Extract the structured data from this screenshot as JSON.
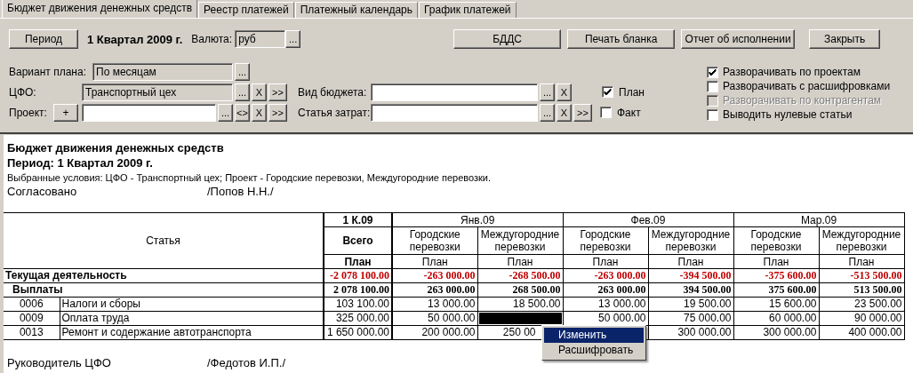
{
  "tabs": [
    {
      "label": "Бюджет движения денежных средств",
      "selected": true
    },
    {
      "label": "Реестр платежей",
      "selected": false
    },
    {
      "label": "Платежный календарь",
      "selected": false
    },
    {
      "label": "График платежей",
      "selected": false
    }
  ],
  "toolbar": {
    "period_button": "Период",
    "period_value": "1 Квартал 2009 г.",
    "currency_label": "Валюта:",
    "currency_value": "руб",
    "currency_picker": "...",
    "buttons": [
      "БДДС",
      "Печать бланка",
      "Отчет об исполнении",
      "Закрыть"
    ]
  },
  "filters": {
    "plan_variant": {
      "label": "Вариант плана:",
      "value": "По месяцам",
      "picker": "..."
    },
    "cfo": {
      "label": "ЦФО:",
      "value": "Транспортный цех",
      "picker": "...",
      "clear": "X",
      "expand": ">>"
    },
    "project": {
      "label": "Проект:",
      "add": "+",
      "picker": "...",
      "toggle": "<>",
      "clear": "X",
      "expand": ">>"
    },
    "budget_type": {
      "label": "Вид бюджета:",
      "picker": "...",
      "clear": "X"
    },
    "expense_item": {
      "label": "Статья затрат:",
      "picker": "...",
      "clear": "X",
      "expand": ">>"
    },
    "data_kinds": [
      {
        "label": "План",
        "checked": true
      },
      {
        "label": "Факт",
        "checked": false
      }
    ],
    "options": [
      {
        "label": "Разворачивать по проектам",
        "checked": true,
        "disabled": false
      },
      {
        "label": "Разворачивать с расшифровками",
        "checked": false,
        "disabled": false
      },
      {
        "label": "Разворачивать по контрагентам",
        "checked": false,
        "disabled": true
      },
      {
        "label": "Выводить нулевые статьи",
        "checked": false,
        "disabled": false
      }
    ]
  },
  "report": {
    "title": "Бюджет движения денежных средств",
    "period": "Период: 1 Квартал 2009 г.",
    "conditions": "Выбранные условия: ЦФО - Транспортный цех; Проект -  Городские перевозки,  Междугородние перевозки.",
    "approved_label": "Согласовано",
    "approved_name": "/Попов Н.Н./",
    "table": {
      "item_header": "Статья",
      "total_period": "1 К.09",
      "total_label": "Всего",
      "months": [
        {
          "label": "Янв.09",
          "subcolumns": [
            "Городские перевозки",
            "Междугородние перевозки"
          ]
        },
        {
          "label": "Фев.09",
          "subcolumns": [
            "Городские перевозки",
            "Междугородние перевозки"
          ]
        },
        {
          "label": "Мар.09",
          "subcolumns": [
            "Городские перевозки",
            "Междугородние перевозки"
          ]
        }
      ],
      "plan_labels": [
        "План",
        "План",
        "План",
        "План",
        "План",
        "План",
        "План"
      ],
      "rows": [
        {
          "kind": "section",
          "name": "Текущая деятельность",
          "cells": [
            {
              "value": "-2 078 100.00",
              "selected": false
            },
            {
              "value": "-263 000.00",
              "selected": false
            },
            {
              "value": "-268 500.00",
              "selected": false
            },
            {
              "value": "-263 000.00",
              "selected": false
            },
            {
              "value": "-394 500.00",
              "selected": false
            },
            {
              "value": "-375 600.00",
              "selected": false
            },
            {
              "value": "-513 500.00",
              "selected": false
            }
          ]
        },
        {
          "kind": "group",
          "name": "Выплаты",
          "cells": [
            {
              "value": "2 078 100.00",
              "selected": false
            },
            {
              "value": "263 000.00",
              "selected": false
            },
            {
              "value": "268 500.00",
              "selected": false
            },
            {
              "value": "263 000.00",
              "selected": false
            },
            {
              "value": "394 500.00",
              "selected": false
            },
            {
              "value": "375 600.00",
              "selected": false
            },
            {
              "value": "513 500.00",
              "selected": false
            }
          ]
        },
        {
          "kind": "item",
          "code": "0006",
          "name": "Налоги и сборы",
          "cells": [
            {
              "value": "103 100.00",
              "selected": false
            },
            {
              "value": "13 000.00",
              "selected": false
            },
            {
              "value": "18 500.00",
              "selected": false
            },
            {
              "value": "13 000.00",
              "selected": false
            },
            {
              "value": "19 500.00",
              "selected": false
            },
            {
              "value": "15 600.00",
              "selected": false
            },
            {
              "value": "23 500.00",
              "selected": false
            }
          ]
        },
        {
          "kind": "item",
          "code": "0009",
          "name": "Оплата труда",
          "cells": [
            {
              "value": "325 000.00",
              "selected": false
            },
            {
              "value": "50 000.00",
              "selected": false
            },
            {
              "selected": true
            },
            {
              "value": "50 000.00",
              "selected": false
            },
            {
              "value": "75 000.00",
              "selected": false
            },
            {
              "value": "60 000.00",
              "selected": false
            },
            {
              "value": "90 000.00",
              "selected": false
            }
          ]
        },
        {
          "kind": "item",
          "code": "0013",
          "name": "Ремонт и содержание автотранспорта",
          "cells": [
            {
              "value": "1 650 000.00",
              "selected": false
            },
            {
              "value": "200 000.00",
              "selected": false
            },
            {
              "value": "250 00",
              "selected": false
            },
            {
              "selected": false
            },
            {
              "value": "300 000.00",
              "selected": false
            },
            {
              "value": "300 000.00",
              "selected": false
            },
            {
              "value": "400 000.00",
              "selected": false
            }
          ]
        }
      ]
    },
    "footer_label": "Руководитель ЦФО",
    "footer_name": "/Федотов И.П./"
  },
  "context_menu": [
    {
      "label": "Изменить",
      "selected": true
    },
    {
      "label": "Расшифровать",
      "selected": false
    }
  ]
}
